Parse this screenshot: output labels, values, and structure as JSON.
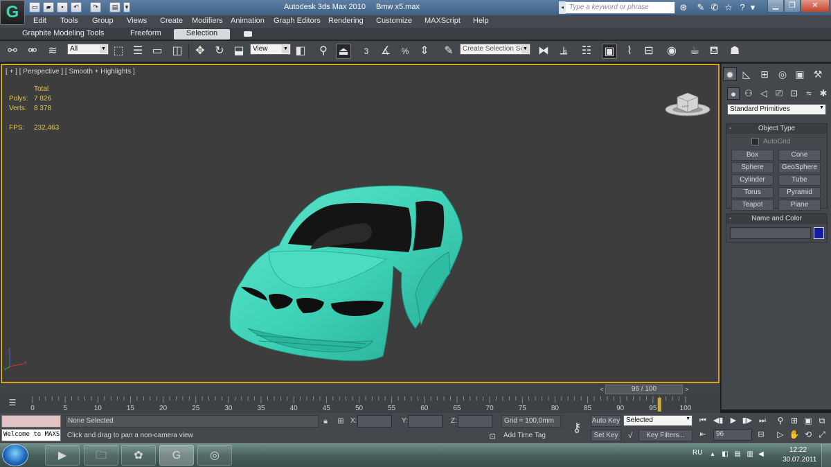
{
  "titlebar": {
    "app_title": "Autodesk 3ds Max  2010",
    "file_name": "Bmw x5.max",
    "search_placeholder": "Type a keyword or phrase"
  },
  "menu": [
    "Edit",
    "Tools",
    "Group",
    "Views",
    "Create",
    "Modifiers",
    "Animation",
    "Graph Editors",
    "Rendering",
    "Customize",
    "MAXScript",
    "Help"
  ],
  "ribbon": {
    "tabs": [
      "Graphite Modeling Tools",
      "Freeform",
      "Selection"
    ],
    "active_tab": "Selection"
  },
  "toolbar": {
    "selection_filter": "All",
    "reference_coord": "View",
    "snap_label": "3",
    "angle_snap_label": "%",
    "named_selection_placeholder": "Create Selection Se"
  },
  "viewport": {
    "label": "[ + ] [ Perspective ] [ Smooth + Highlights ]",
    "stats": {
      "total_label": "Total",
      "polys_label": "Polys:",
      "polys_value": "7 826",
      "verts_label": "Verts:",
      "verts_value": "8 378",
      "fps_label": "FPS:",
      "fps_value": "232,463"
    },
    "viewcube_label": "LEFT",
    "axis_labels": {
      "z": "z",
      "x": "x",
      "y": "y"
    }
  },
  "command_panel": {
    "category": "Standard Primitives",
    "object_type": {
      "title": "Object Type",
      "autogrid_label": "AutoGrid",
      "autogrid_checked": false,
      "buttons": [
        "Box",
        "Cone",
        "Sphere",
        "GeoSphere",
        "Cylinder",
        "Tube",
        "Torus",
        "Pyramid",
        "Teapot",
        "Plane"
      ]
    },
    "name_and_color": {
      "title": "Name and Color",
      "name_value": "",
      "color": "#1a1a9f"
    }
  },
  "timeline": {
    "current_frame": 96,
    "frame_display": "96 / 100",
    "ticks": [
      "0",
      "5",
      "10",
      "15",
      "20",
      "25",
      "30",
      "35",
      "40",
      "45",
      "50",
      "55",
      "60",
      "65",
      "70",
      "75",
      "80",
      "85",
      "90",
      "95",
      "100"
    ]
  },
  "status": {
    "maxscript_text": "Welcome to MAXScript.",
    "selection_status": "None Selected",
    "prompt": "Click and drag to pan a non-camera view",
    "x_label": "X:",
    "y_label": "Y:",
    "z_label": "Z:",
    "x_value": "",
    "y_value": "",
    "z_value": "",
    "grid": "Grid = 100,0mm",
    "add_time_tag": "Add Time Tag",
    "auto_key": "Auto Key",
    "set_key": "Set Key",
    "key_filter_selected": "Selected",
    "key_filters": "Key Filters...",
    "frame_field": "96"
  },
  "taskbar": {
    "language": "RU",
    "time": "12:22",
    "date": "30.07.2011"
  },
  "colors": {
    "viewport_bg": "#3d3d3d",
    "active_viewport_border": "#d6a31c",
    "model_color": "#3fd3b8",
    "stats_color": "#e3c65c"
  }
}
